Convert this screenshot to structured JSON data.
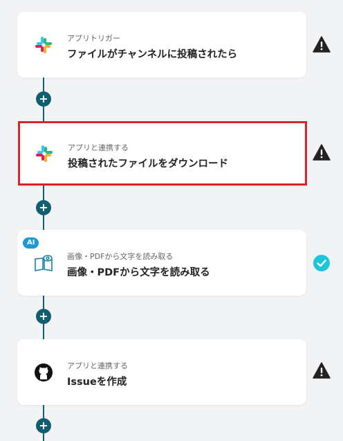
{
  "colors": {
    "connector": "#0f5f70",
    "selected_border": "#d5242a",
    "warning": "#222222",
    "success": "#1ec6d9",
    "ai_badge": "#1a9ad6"
  },
  "steps": [
    {
      "icon": "slack-icon",
      "subtitle": "アプリトリガー",
      "title": "ファイルがチャンネルに投稿されたら",
      "status": "warning-icon"
    },
    {
      "icon": "slack-icon",
      "subtitle": "アプリと連携する",
      "title": "投稿されたファイルをダウンロード",
      "status": "warning-icon",
      "selected": true
    },
    {
      "icon": "ocr-book-icon",
      "badge": "AI",
      "subtitle": "画像・PDFから文字を読み取る",
      "title": "画像・PDFから文字を読み取る",
      "status": "check-icon"
    },
    {
      "icon": "github-icon",
      "subtitle": "アプリと連携する",
      "title": "Issueを作成",
      "status": "warning-icon"
    }
  ],
  "add_button_label": "+"
}
